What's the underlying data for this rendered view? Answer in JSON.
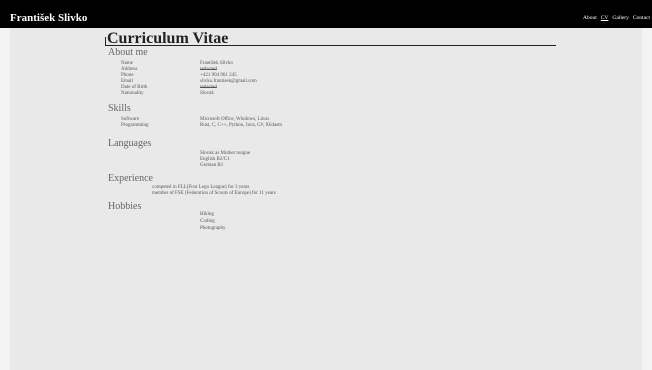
{
  "header": {
    "brand": "František Slivko",
    "nav": [
      {
        "label": "About"
      },
      {
        "label": "CV"
      },
      {
        "label": "Gallery"
      },
      {
        "label": "Contact"
      }
    ]
  },
  "cv": {
    "title": "Curriculum Vitae",
    "about": {
      "heading": "About me",
      "rows": [
        {
          "label": "Name",
          "value": "František Slivko"
        },
        {
          "label": "Address",
          "value": "redacted"
        },
        {
          "label": "Phone",
          "value": "+421 904 961 245"
        },
        {
          "label": "Email",
          "value": "slivko.frantisek@gmail.com"
        },
        {
          "label": "Date of Birth",
          "value": "redacted"
        },
        {
          "label": "Nationality",
          "value": "Slovak"
        }
      ]
    },
    "skills": {
      "heading": "Skills",
      "rows": [
        {
          "label": "Software",
          "value": "Microsoft Office, Windows, Linux"
        },
        {
          "label": "Programming",
          "value": "Rust, C, C++, Python, Java, C#, X64asm"
        }
      ]
    },
    "languages": {
      "heading": "Languages",
      "items": [
        "Slovak as Mother tongue",
        "English B2/C1",
        "German B1"
      ]
    },
    "experience": {
      "heading": "Experience",
      "items": [
        "competed in FLL(First Lego League) for 3 years",
        "member of FSE (Federation of Scouts of Europe) for 11 years"
      ]
    },
    "hobbies": {
      "heading": "Hobbies",
      "items": [
        "Hiking",
        "Coding",
        "Photography"
      ]
    }
  }
}
